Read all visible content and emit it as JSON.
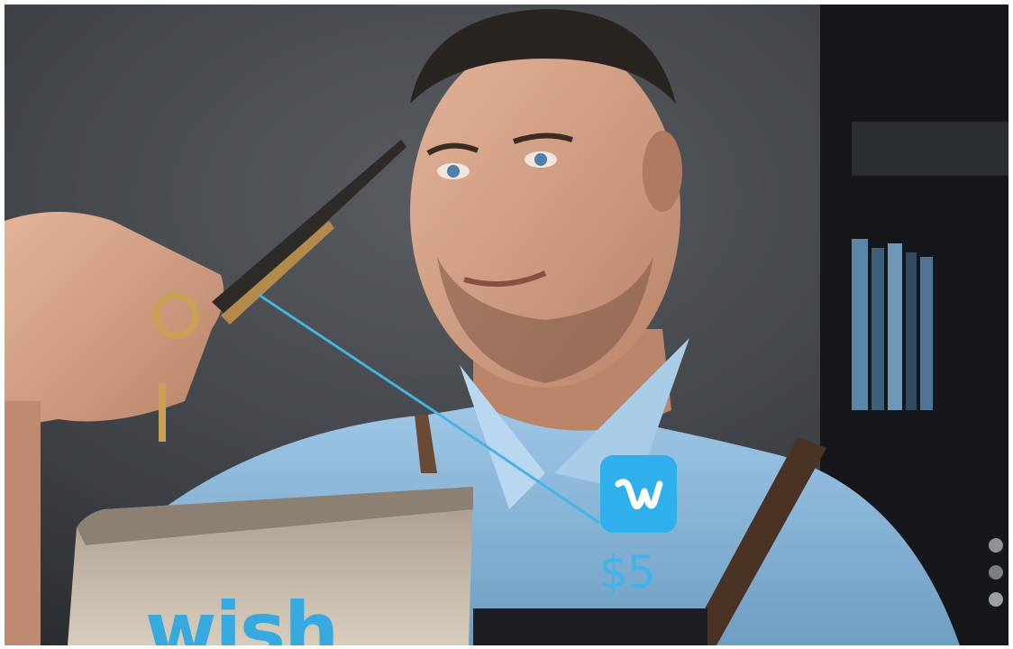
{
  "scene": {
    "description_icons": [
      "person",
      "scissors",
      "shipping-box"
    ]
  },
  "overlay": {
    "logo_icon": "wish-w-logo-icon",
    "price": "$5",
    "accent_color": "#2fb0ec"
  },
  "package": {
    "brand": "wish"
  }
}
